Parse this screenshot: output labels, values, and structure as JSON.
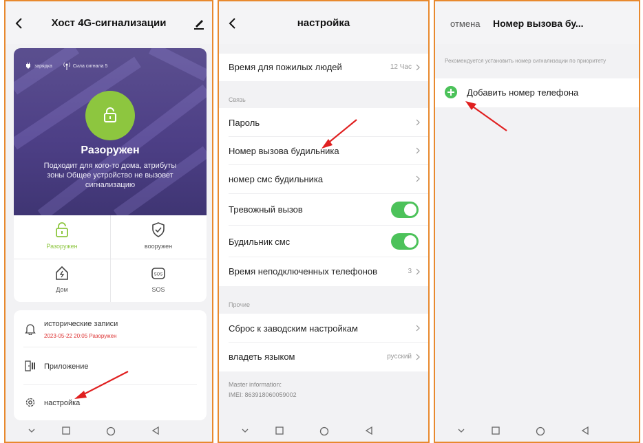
{
  "panel1": {
    "title": "Хост 4G-сигнализации",
    "status_battery": "зарядка",
    "status_signal": "Сила сигнала 5",
    "state_label": "Разоружен",
    "state_description": "Подходит для кого-то дома, атрибуты зоны Общее устройство не вызовет сигнализацию",
    "modes": [
      {
        "label": "Разоружен",
        "icon": "unlock-icon",
        "active": true
      },
      {
        "label": "вооружен",
        "icon": "shield-icon",
        "active": false
      },
      {
        "label": "Дом",
        "icon": "home-icon",
        "active": false
      },
      {
        "label": "SOS",
        "icon": "sos-icon",
        "active": false
      }
    ],
    "menu": {
      "history_label": "исторические записи",
      "history_sub": "2023-05-22 20:05 Разоружен",
      "app_label": "Приложение",
      "settings_label": "настройка"
    }
  },
  "panel2": {
    "title": "настройка",
    "elderly_label": "Время для пожилых людей",
    "elderly_value": "12 Час",
    "section_link": "Связь",
    "password_label": "Пароль",
    "alarm_call_label": "Номер вызова будильника",
    "alarm_sms_label": "номер смс будильника",
    "alarm_call_toggle_label": "Тревожный вызов",
    "alarm_call_toggle_on": true,
    "alarm_sms_toggle_label": "Будильник смс",
    "alarm_sms_toggle_on": true,
    "unconnected_label": "Время неподключенных телефонов",
    "unconnected_value": "3",
    "section_other": "Прочие",
    "reset_label": "Сброс к заводским настройкам",
    "language_label": "владеть языком",
    "language_value": "русский",
    "master_info": "Master information:",
    "imei": "IMEI: 863918060059002"
  },
  "panel3": {
    "cancel_label": "отмена",
    "title": "Номер вызова бу...",
    "recommend_text": "Рекомендуется установить номер сигнализации по приоритету",
    "add_label": "Добавить номер телефона"
  },
  "colors": {
    "accent_green": "#8dc63f",
    "toggle_green": "#4cc25a",
    "hero_purple": "#4d3f86",
    "annotation_red": "#e02020",
    "panel_border": "#e8892e"
  }
}
